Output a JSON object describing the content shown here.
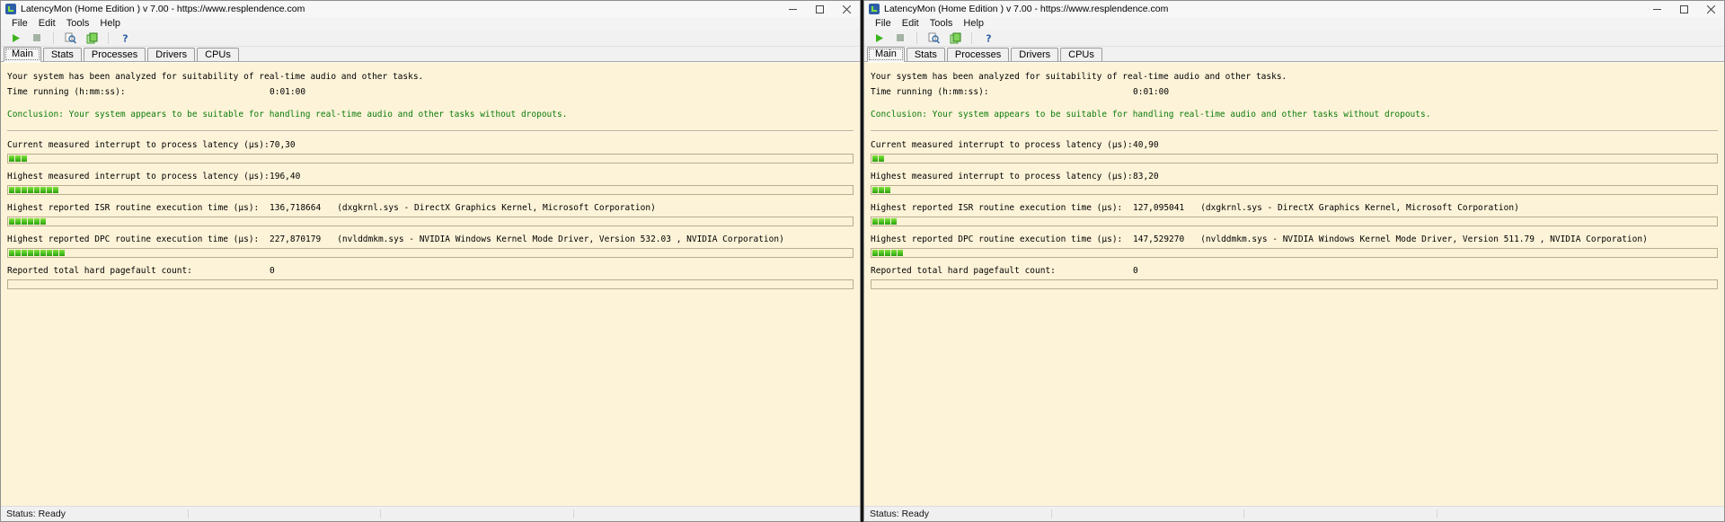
{
  "windows": [
    {
      "title": "LatencyMon  (Home Edition )  v 7.00 - https://www.resplendence.com",
      "menu": [
        "File",
        "Edit",
        "Tools",
        "Help"
      ],
      "toolbar_icons": [
        "play-icon",
        "stop-icon",
        "analyze-icon",
        "report-icon",
        "help-icon"
      ],
      "tabs": [
        "Main",
        "Stats",
        "Processes",
        "Drivers",
        "CPUs"
      ],
      "active_tab": "Main",
      "analysis": "Your system has been analyzed for suitability of real-time audio and other tasks.",
      "time_label": "Time running (h:mm:ss):",
      "time_value": "0:01:00",
      "conclusion": "Conclusion: Your system appears to be suitable for handling real-time audio and other tasks without dropouts.",
      "metrics": [
        {
          "label": "Current measured interrupt to process latency (µs):",
          "value": "70,30",
          "detail": "",
          "bar_segments": 3
        },
        {
          "label": "Highest measured interrupt to process latency (µs):",
          "value": "196,40",
          "detail": "",
          "bar_segments": 8
        },
        {
          "label": "Highest reported ISR routine execution time (µs):",
          "value": "136,718664",
          "detail": "(dxgkrnl.sys - DirectX Graphics Kernel, Microsoft Corporation)",
          "bar_segments": 6
        },
        {
          "label": "Highest reported DPC routine execution time (µs):",
          "value": "227,870179",
          "detail": "(nvlddmkm.sys - NVIDIA Windows Kernel Mode Driver, Version 532.03 , NVIDIA Corporation)",
          "bar_segments": 9
        },
        {
          "label": "Reported total hard pagefault count:",
          "value": "0",
          "detail": "",
          "bar_segments": 0
        }
      ],
      "status": "Status: Ready"
    },
    {
      "title": "LatencyMon  (Home Edition )  v 7.00 - https://www.resplendence.com",
      "menu": [
        "File",
        "Edit",
        "Tools",
        "Help"
      ],
      "toolbar_icons": [
        "play-icon",
        "stop-icon",
        "analyze-icon",
        "report-icon",
        "help-icon"
      ],
      "tabs": [
        "Main",
        "Stats",
        "Processes",
        "Drivers",
        "CPUs"
      ],
      "active_tab": "Main",
      "analysis": "Your system has been analyzed for suitability of real-time audio and other tasks.",
      "time_label": "Time running (h:mm:ss):",
      "time_value": "0:01:00",
      "conclusion": "Conclusion: Your system appears to be suitable for handling real-time audio and other tasks without dropouts.",
      "metrics": [
        {
          "label": "Current measured interrupt to process latency (µs):",
          "value": "40,90",
          "detail": "",
          "bar_segments": 2
        },
        {
          "label": "Highest measured interrupt to process latency (µs):",
          "value": "83,20",
          "detail": "",
          "bar_segments": 3
        },
        {
          "label": "Highest reported ISR routine execution time (µs):",
          "value": "127,095041",
          "detail": "(dxgkrnl.sys - DirectX Graphics Kernel, Microsoft Corporation)",
          "bar_segments": 4
        },
        {
          "label": "Highest reported DPC routine execution time (µs):",
          "value": "147,529270",
          "detail": "(nvlddmkm.sys - NVIDIA Windows Kernel Mode Driver, Version 511.79 , NVIDIA Corporation)",
          "bar_segments": 5
        },
        {
          "label": "Reported total hard pagefault count:",
          "value": "0",
          "detail": "",
          "bar_segments": 0
        }
      ],
      "status": "Status: Ready"
    }
  ],
  "colors": {
    "panel_bg": "#fdf3d8",
    "conclusion_green": "#0b7c0b",
    "bar_green": "#4cc222",
    "chrome": "#f1f1f1"
  }
}
